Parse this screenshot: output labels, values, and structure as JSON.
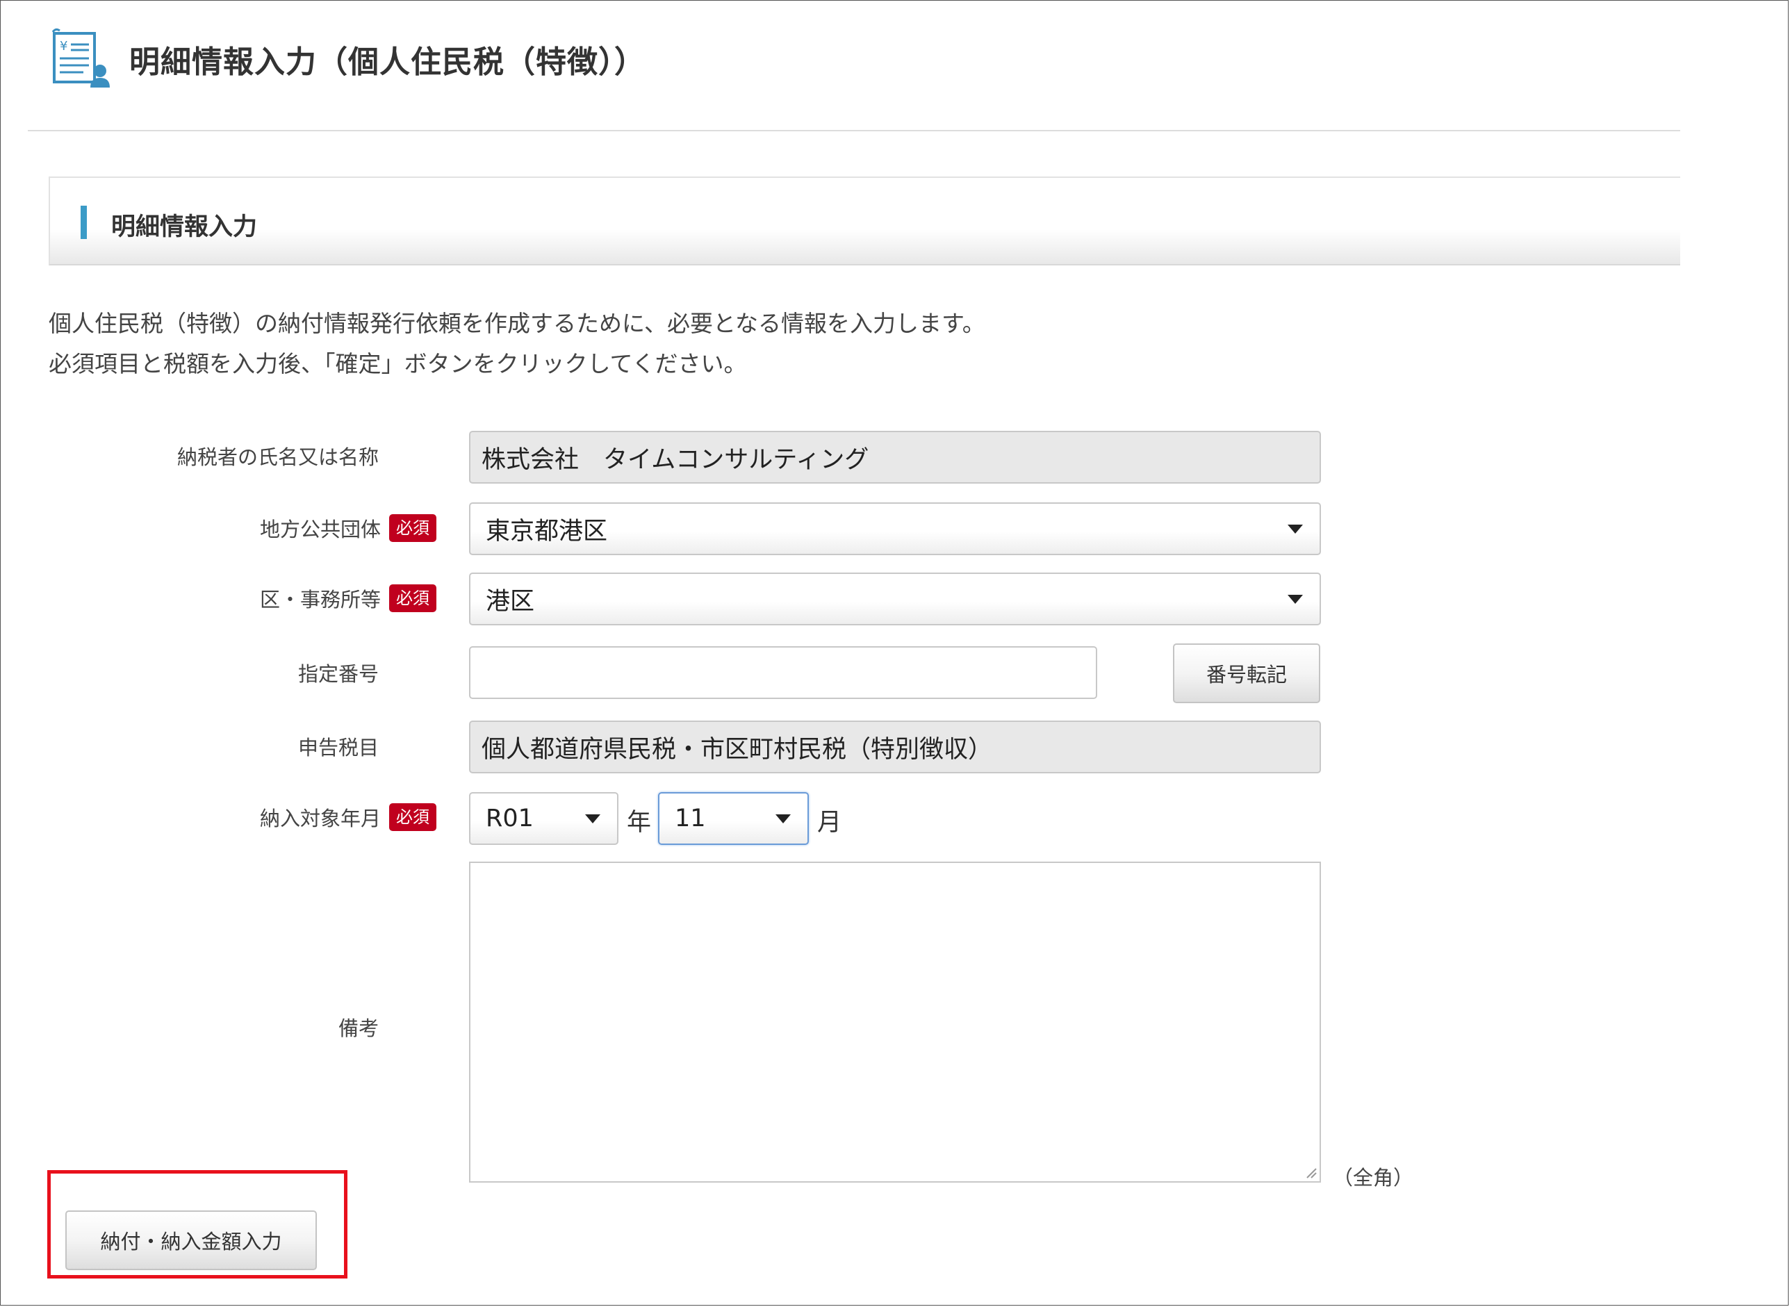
{
  "page": {
    "title": "明細情報入力（個人住民税（特徴））",
    "icon": "tax-document-icon"
  },
  "section": {
    "title": "明細情報入力"
  },
  "description": [
    "個人住民税（特徴）の納付情報発行依頼を作成するために、必要となる情報を入力します。",
    "必須項目と税額を入力後、「確定」ボタンをクリックしてください。"
  ],
  "required_label": "必須",
  "form": {
    "taxpayer_name": {
      "label": "納税者の氏名又は名称",
      "value": "株式会社　タイムコンサルティング"
    },
    "local_government": {
      "label": "地方公共団体",
      "value": "東京都港区"
    },
    "ward_office": {
      "label": "区・事務所等",
      "value": "港区"
    },
    "designated_number": {
      "label": "指定番号",
      "value": "",
      "transfer_button": "番号転記"
    },
    "tax_item": {
      "label": "申告税目",
      "value": "個人都道府県民税・市区町村民税（特別徴収）"
    },
    "target_period": {
      "label": "納入対象年月",
      "year": "R01",
      "year_unit": "年",
      "month": "11",
      "month_unit": "月"
    },
    "remarks": {
      "label": "備考",
      "value": "",
      "note": "（全角）"
    }
  },
  "actions": {
    "amount_input_button": "納付・納入金額入力"
  },
  "colors": {
    "required_badge": "#c0001e",
    "section_accent": "#3b9bc7",
    "highlight": "#e8101c"
  }
}
